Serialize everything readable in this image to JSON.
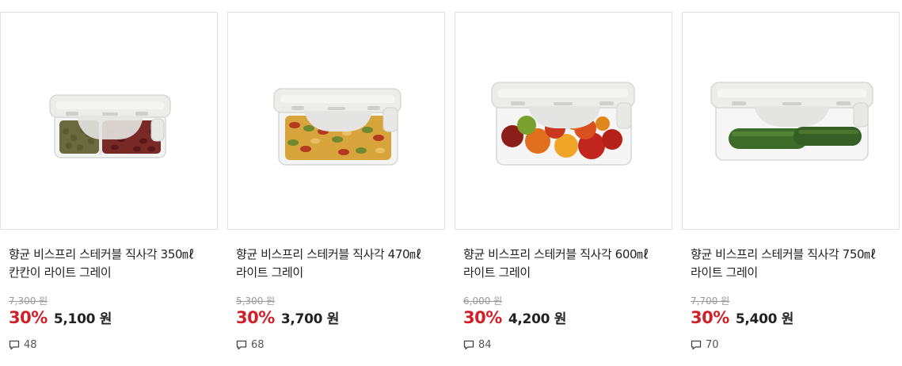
{
  "products": [
    {
      "name_line1": "향균 비스프리 스테커블 직사각 350㎖",
      "name_line2": "칸칸이 라이트 그레이",
      "original_price": "7,300 원",
      "discount_rate": "30%",
      "sale_price": "5,100 원",
      "review_count": "48",
      "image": "container-with-beans"
    },
    {
      "name_line1": "향균 비스프리 스테커블 직사각 470㎖",
      "name_line2": "라이트 그레이",
      "original_price": "5,300 원",
      "discount_rate": "30%",
      "sale_price": "3,700 원",
      "review_count": "68",
      "image": "container-with-pasta"
    },
    {
      "name_line1": "향균 비스프리 스테커블 직사각 600㎖",
      "name_line2": "라이트 그레이",
      "original_price": "6,000 원",
      "discount_rate": "30%",
      "sale_price": "4,200 원",
      "review_count": "84",
      "image": "container-with-tomatoes"
    },
    {
      "name_line1": "향균 비스프리 스테커블 직사각 750㎖",
      "name_line2": "라이트 그레이",
      "original_price": "7,700 원",
      "discount_rate": "30%",
      "sale_price": "5,400 원",
      "review_count": "70",
      "image": "container-with-cucumbers"
    }
  ],
  "colors": {
    "discount": "#d0202a",
    "border": "#e2e2e2",
    "lid": "#ececea"
  },
  "icons": {
    "review": "speech-bubble-icon"
  }
}
